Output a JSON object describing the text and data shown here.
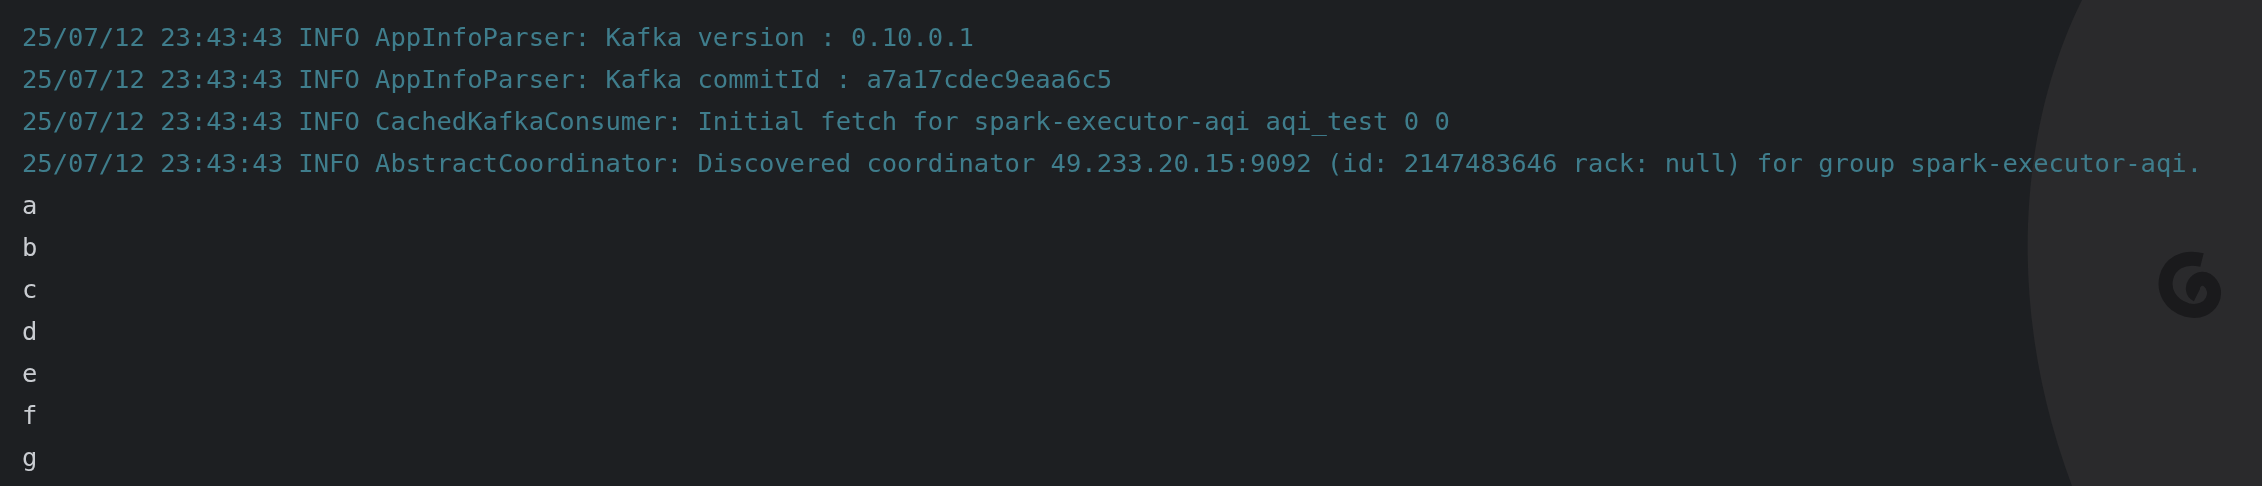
{
  "log_lines": [
    {
      "kind": "log",
      "text": "25/07/12 23:43:43 INFO AppInfoParser: Kafka version : 0.10.0.1"
    },
    {
      "kind": "log",
      "text": "25/07/12 23:43:43 INFO AppInfoParser: Kafka commitId : a7a17cdec9eaa6c5"
    },
    {
      "kind": "log",
      "text": "25/07/12 23:43:43 INFO CachedKafkaConsumer: Initial fetch for spark-executor-aqi aqi_test 0 0"
    },
    {
      "kind": "log",
      "text": "25/07/12 23:43:43 INFO AbstractCoordinator: Discovered coordinator 49.233.20.15:9092 (id: 2147483646 rack: null) for group spark-executor-aqi."
    },
    {
      "kind": "input",
      "text": "a"
    },
    {
      "kind": "input",
      "text": "b"
    },
    {
      "kind": "input",
      "text": "c"
    },
    {
      "kind": "input",
      "text": "d"
    },
    {
      "kind": "input",
      "text": "e"
    },
    {
      "kind": "input",
      "text": "f"
    },
    {
      "kind": "input",
      "text": "g"
    }
  ]
}
